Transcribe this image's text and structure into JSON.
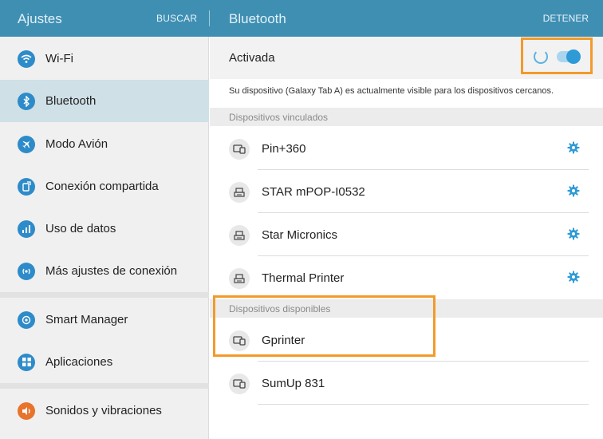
{
  "header": {
    "left_title": "Ajustes",
    "search_label": "BUSCAR",
    "right_title": "Bluetooth",
    "stop_label": "DETENER",
    "color": "#3f8fb3"
  },
  "sidebar": {
    "items": [
      {
        "label": "Wi-Fi",
        "icon": "wifi-icon",
        "color": "#2e8bc9"
      },
      {
        "label": "Bluetooth",
        "icon": "bluetooth-icon",
        "color": "#2e8bc9"
      },
      {
        "label": "Modo Avión",
        "icon": "airplane-icon",
        "color": "#2e8bc9"
      },
      {
        "label": "Conexión compartida",
        "icon": "tethering-icon",
        "color": "#2e8bc9"
      },
      {
        "label": "Uso de datos",
        "icon": "data-usage-icon",
        "color": "#2e8bc9"
      },
      {
        "label": "Más ajustes de conexión",
        "icon": "more-connections-icon",
        "color": "#2e8bc9"
      },
      {
        "label": "Smart Manager",
        "icon": "smart-manager-icon",
        "color": "#2e8bc9"
      },
      {
        "label": "Aplicaciones",
        "icon": "apps-icon",
        "color": "#2e8bc9"
      },
      {
        "label": "Sonidos y vibraciones",
        "icon": "sound-icon",
        "color": "#e8732c"
      }
    ]
  },
  "bluetooth": {
    "status_label": "Activada",
    "enabled": true,
    "visibility_note": "Su dispositivo (Galaxy Tab A) es actualmente visible para los dispositivos cercanos.",
    "paired_header": "Dispositivos vinculados",
    "paired": [
      {
        "name": "Pin+360",
        "icon": "tablet-phone-icon"
      },
      {
        "name": "STAR mPOP-I0532",
        "icon": "printer-icon"
      },
      {
        "name": "Star Micronics",
        "icon": "printer-icon"
      },
      {
        "name": "Thermal Printer",
        "icon": "printer-icon"
      }
    ],
    "available_header": "Dispositivos disponibles",
    "available": [
      {
        "name": "Gprinter",
        "icon": "tablet-phone-icon"
      },
      {
        "name": "SumUp 831",
        "icon": "tablet-phone-icon"
      }
    ],
    "accent": "#2e9ad6",
    "highlight": "#f39a2b"
  }
}
